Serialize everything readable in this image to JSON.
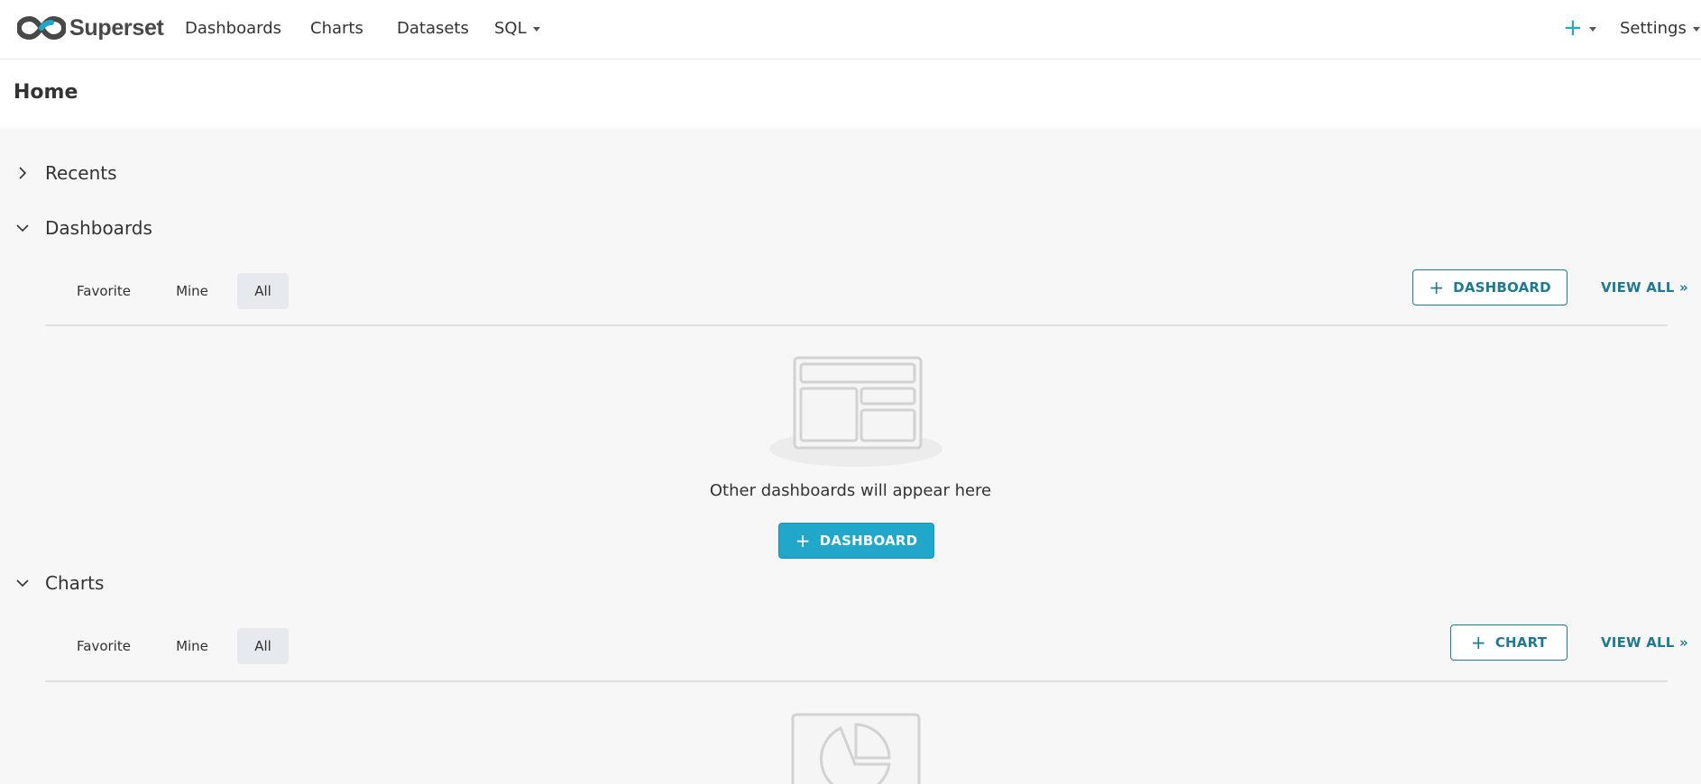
{
  "app": {
    "brand": "Superset"
  },
  "nav": {
    "items": [
      {
        "label": "Dashboards"
      },
      {
        "label": "Charts"
      },
      {
        "label": "Datasets"
      },
      {
        "label": "SQL"
      }
    ],
    "plus_icon": "plus-icon",
    "settings_label": "Settings"
  },
  "page": {
    "title": "Home"
  },
  "sections": {
    "recents": {
      "title": "Recents",
      "expanded": false
    },
    "dashboards": {
      "title": "Dashboards",
      "expanded": true,
      "tabs": [
        {
          "label": "Favorite",
          "active": false
        },
        {
          "label": "Mine",
          "active": false
        },
        {
          "label": "All",
          "active": true
        }
      ],
      "add_button_label": "DASHBOARD",
      "view_all_label": "VIEW ALL »",
      "empty_text": "Other dashboards will appear here",
      "empty_button_label": "DASHBOARD"
    },
    "charts": {
      "title": "Charts",
      "expanded": true,
      "tabs": [
        {
          "label": "Favorite",
          "active": false
        },
        {
          "label": "Mine",
          "active": false
        },
        {
          "label": "All",
          "active": true
        }
      ],
      "add_button_label": "CHART",
      "view_all_label": "VIEW ALL »"
    }
  },
  "colors": {
    "brand_primary": "#20a7c9",
    "brand_dark": "#1f7a91",
    "background": "#f7f7f7",
    "active_tab": "#e6e9ed"
  }
}
